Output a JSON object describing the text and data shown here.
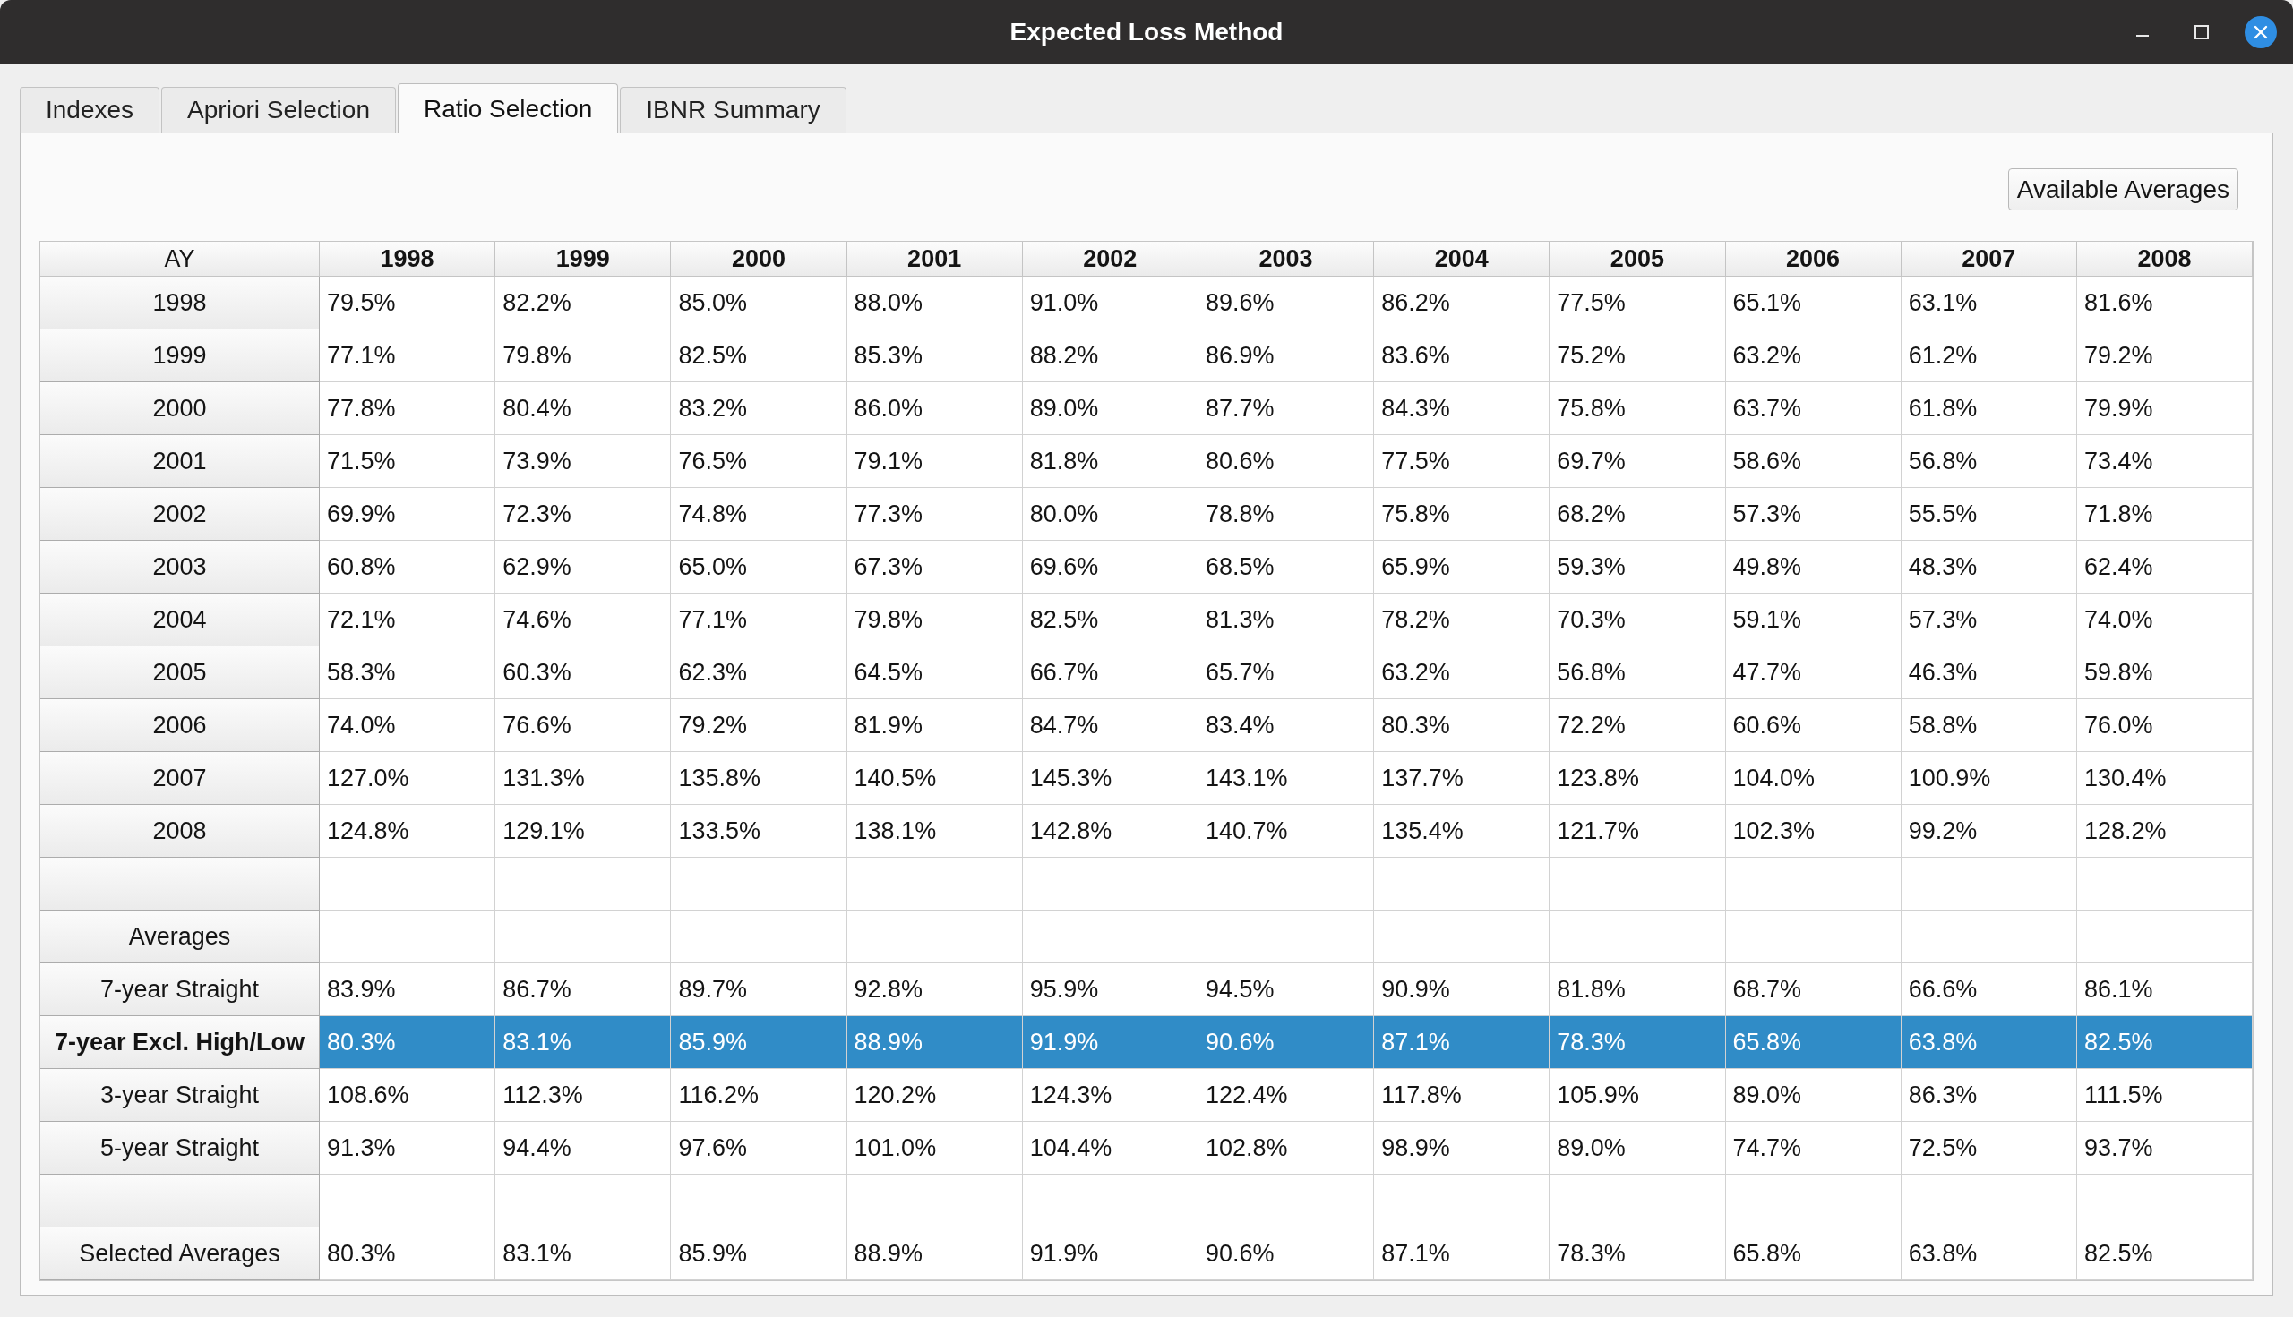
{
  "window": {
    "title": "Expected Loss Method"
  },
  "tabs": [
    {
      "label": "Indexes",
      "selected": false
    },
    {
      "label": "Apriori Selection",
      "selected": false
    },
    {
      "label": "Ratio Selection",
      "selected": true
    },
    {
      "label": "IBNR Summary",
      "selected": false
    }
  ],
  "buttons": [
    {
      "label": "Available Averages"
    }
  ],
  "table": {
    "corner_header": "AY",
    "columns": [
      "1998",
      "1999",
      "2000",
      "2001",
      "2002",
      "2003",
      "2004",
      "2005",
      "2006",
      "2007",
      "2008"
    ],
    "rows": [
      {
        "kind": "data",
        "header": "1998",
        "selected": false,
        "cells": [
          "79.5%",
          "82.2%",
          "85.0%",
          "88.0%",
          "91.0%",
          "89.6%",
          "86.2%",
          "77.5%",
          "65.1%",
          "63.1%",
          "81.6%"
        ]
      },
      {
        "kind": "data",
        "header": "1999",
        "selected": false,
        "cells": [
          "77.1%",
          "79.8%",
          "82.5%",
          "85.3%",
          "88.2%",
          "86.9%",
          "83.6%",
          "75.2%",
          "63.2%",
          "61.2%",
          "79.2%"
        ]
      },
      {
        "kind": "data",
        "header": "2000",
        "selected": false,
        "cells": [
          "77.8%",
          "80.4%",
          "83.2%",
          "86.0%",
          "89.0%",
          "87.7%",
          "84.3%",
          "75.8%",
          "63.7%",
          "61.8%",
          "79.9%"
        ]
      },
      {
        "kind": "data",
        "header": "2001",
        "selected": false,
        "cells": [
          "71.5%",
          "73.9%",
          "76.5%",
          "79.1%",
          "81.8%",
          "80.6%",
          "77.5%",
          "69.7%",
          "58.6%",
          "56.8%",
          "73.4%"
        ]
      },
      {
        "kind": "data",
        "header": "2002",
        "selected": false,
        "cells": [
          "69.9%",
          "72.3%",
          "74.8%",
          "77.3%",
          "80.0%",
          "78.8%",
          "75.8%",
          "68.2%",
          "57.3%",
          "55.5%",
          "71.8%"
        ]
      },
      {
        "kind": "data",
        "header": "2003",
        "selected": false,
        "cells": [
          "60.8%",
          "62.9%",
          "65.0%",
          "67.3%",
          "69.6%",
          "68.5%",
          "65.9%",
          "59.3%",
          "49.8%",
          "48.3%",
          "62.4%"
        ]
      },
      {
        "kind": "data",
        "header": "2004",
        "selected": false,
        "cells": [
          "72.1%",
          "74.6%",
          "77.1%",
          "79.8%",
          "82.5%",
          "81.3%",
          "78.2%",
          "70.3%",
          "59.1%",
          "57.3%",
          "74.0%"
        ]
      },
      {
        "kind": "data",
        "header": "2005",
        "selected": false,
        "cells": [
          "58.3%",
          "60.3%",
          "62.3%",
          "64.5%",
          "66.7%",
          "65.7%",
          "63.2%",
          "56.8%",
          "47.7%",
          "46.3%",
          "59.8%"
        ]
      },
      {
        "kind": "data",
        "header": "2006",
        "selected": false,
        "cells": [
          "74.0%",
          "76.6%",
          "79.2%",
          "81.9%",
          "84.7%",
          "83.4%",
          "80.3%",
          "72.2%",
          "60.6%",
          "58.8%",
          "76.0%"
        ]
      },
      {
        "kind": "data",
        "header": "2007",
        "selected": false,
        "cells": [
          "127.0%",
          "131.3%",
          "135.8%",
          "140.5%",
          "145.3%",
          "143.1%",
          "137.7%",
          "123.8%",
          "104.0%",
          "100.9%",
          "130.4%"
        ]
      },
      {
        "kind": "data",
        "header": "2008",
        "selected": false,
        "cells": [
          "124.8%",
          "129.1%",
          "133.5%",
          "138.1%",
          "142.8%",
          "140.7%",
          "135.4%",
          "121.7%",
          "102.3%",
          "99.2%",
          "128.2%"
        ]
      },
      {
        "kind": "spacer",
        "selected": false
      },
      {
        "kind": "section",
        "header": "Averages",
        "selected": false
      },
      {
        "kind": "data",
        "header": "7-year Straight",
        "selected": false,
        "cells": [
          "83.9%",
          "86.7%",
          "89.7%",
          "92.8%",
          "95.9%",
          "94.5%",
          "90.9%",
          "81.8%",
          "68.7%",
          "66.6%",
          "86.1%"
        ]
      },
      {
        "kind": "data",
        "header": "7-year Excl. High/Low",
        "selected": true,
        "cells": [
          "80.3%",
          "83.1%",
          "85.9%",
          "88.9%",
          "91.9%",
          "90.6%",
          "87.1%",
          "78.3%",
          "65.8%",
          "63.8%",
          "82.5%"
        ]
      },
      {
        "kind": "data",
        "header": "3-year Straight",
        "selected": false,
        "cells": [
          "108.6%",
          "112.3%",
          "116.2%",
          "120.2%",
          "124.3%",
          "122.4%",
          "117.8%",
          "105.9%",
          "89.0%",
          "86.3%",
          "111.5%"
        ]
      },
      {
        "kind": "data",
        "header": "5-year Straight",
        "selected": false,
        "cells": [
          "91.3%",
          "94.4%",
          "97.6%",
          "101.0%",
          "104.4%",
          "102.8%",
          "98.9%",
          "89.0%",
          "74.7%",
          "72.5%",
          "93.7%"
        ]
      },
      {
        "kind": "spacer",
        "selected": false
      },
      {
        "kind": "data",
        "header": "Selected Averages",
        "selected": false,
        "cells": [
          "80.3%",
          "83.1%",
          "85.9%",
          "88.9%",
          "91.9%",
          "90.6%",
          "87.1%",
          "78.3%",
          "65.8%",
          "63.8%",
          "82.5%"
        ]
      }
    ]
  }
}
